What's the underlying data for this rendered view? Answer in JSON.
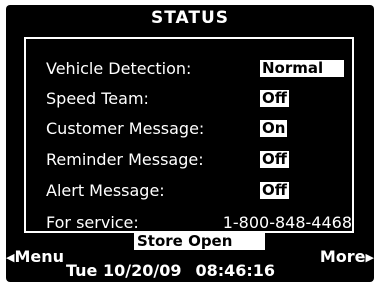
{
  "title": "STATUS",
  "fields": [
    {
      "label": "Vehicle Detection:",
      "value": "Normal"
    },
    {
      "label": "Speed Team:",
      "value": "Off"
    },
    {
      "label": "Customer Message:",
      "value": "On"
    },
    {
      "label": "Reminder Message:",
      "value": "Off"
    },
    {
      "label": "Alert Message:",
      "value": "Off"
    }
  ],
  "service": {
    "label": "For service:",
    "phone": "1-800-848-4468"
  },
  "store_status": "Store Open",
  "softkeys": {
    "left": "Menu",
    "right": "More",
    "left_icon": "left-triangle",
    "right_icon": "right-triangle"
  },
  "datetime": {
    "date": "Tue 10/20/09",
    "time": "08:46:16"
  },
  "colors": {
    "background": "#000000",
    "text": "#ffffff"
  }
}
